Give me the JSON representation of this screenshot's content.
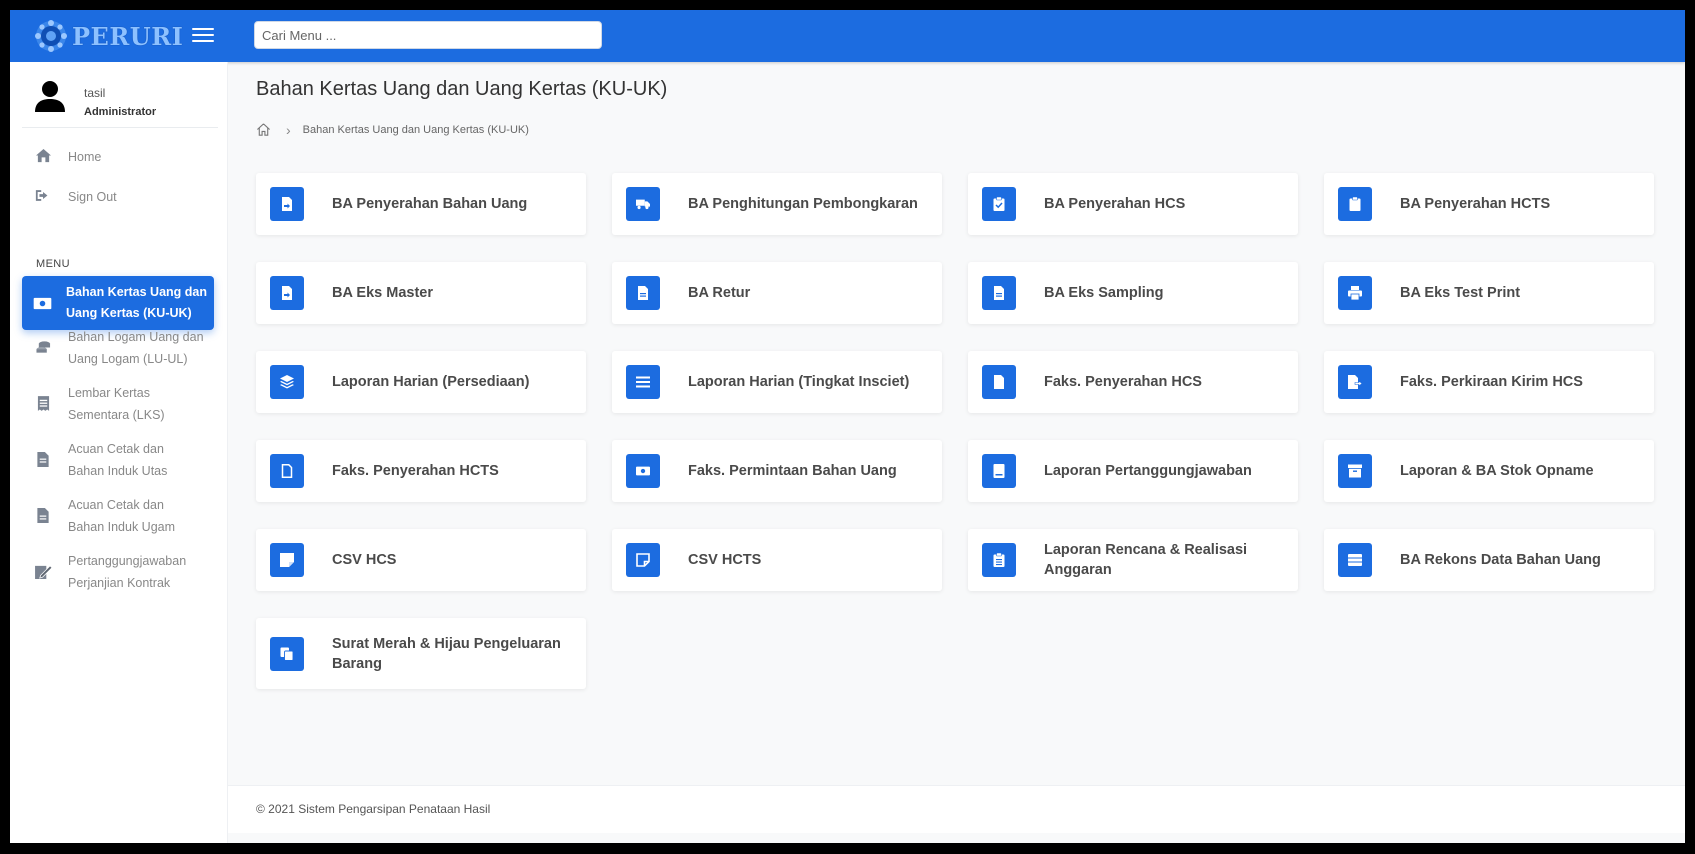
{
  "app": {
    "logo_text": "PERURI",
    "brand_color": "#1c6ce0"
  },
  "search": {
    "placeholder": "Cari Menu ...",
    "value": ""
  },
  "user": {
    "name": "tasil",
    "role": "Administrator"
  },
  "sidebar": {
    "top_items": [
      {
        "label": "Home",
        "icon": "home-icon"
      },
      {
        "label": "Sign Out",
        "icon": "sign-out-icon"
      }
    ],
    "menu_heading": "MENU",
    "menu_items": [
      {
        "label": "Bahan Kertas Uang dan Uang Kertas (KU-UK)",
        "line1": "Bahan Kertas Uang dan",
        "line2": "Uang Kertas (KU-UK)",
        "icon": "money-bill-icon",
        "active": true
      },
      {
        "label": "Bahan Logam Uang dan Uang Logam (LU-UL)",
        "line1": "Bahan Logam Uang dan",
        "line2": "Uang Logam (LU-UL)",
        "icon": "coins-icon",
        "active": false
      },
      {
        "label": "Lembar Kertas Sementara (LKS)",
        "line1": "Lembar Kertas",
        "line2": "Sementara (LKS)",
        "icon": "receipt-icon",
        "active": false
      },
      {
        "label": "Acuan Cetak dan Bahan Induk Utas",
        "line1": "Acuan Cetak dan",
        "line2": "Bahan Induk Utas",
        "icon": "file-alt-icon",
        "active": false
      },
      {
        "label": "Acuan Cetak dan Bahan Induk Ugam",
        "line1": "Acuan Cetak dan",
        "line2": "Bahan Induk Ugam",
        "icon": "file-icon",
        "active": false
      },
      {
        "label": "Pertanggungjawaban Perjanjian Kontrak",
        "line1": "Pertanggungjawaban",
        "line2": "Perjanjian Kontrak",
        "icon": "signature-icon",
        "active": false
      }
    ]
  },
  "main": {
    "title": "Bahan Kertas Uang dan Uang Kertas (KU-UK)",
    "breadcrumb": [
      "Bahan Kertas Uang dan Uang Kertas (KU-UK)"
    ],
    "cards": [
      {
        "title": "BA Penyerahan Bahan Uang",
        "icon": "file-import-icon"
      },
      {
        "title": "BA Penghitungan Pembongkaran",
        "icon": "truck-icon"
      },
      {
        "title": "BA Penyerahan HCS",
        "icon": "clipboard-check-icon"
      },
      {
        "title": "BA Penyerahan HCTS",
        "icon": "clipboard-icon"
      },
      {
        "title": "BA Eks Master",
        "icon": "file-import-icon"
      },
      {
        "title": "BA Retur",
        "icon": "file-alt-icon"
      },
      {
        "title": "BA Eks Sampling",
        "icon": "file-alt-icon"
      },
      {
        "title": "BA Eks Test Print",
        "icon": "print-icon"
      },
      {
        "title": "Laporan Harian (Persediaan)",
        "icon": "layer-group-icon"
      },
      {
        "title": "Laporan Harian (Tingkat Insciet)",
        "icon": "list-icon"
      },
      {
        "title": "Faks. Penyerahan HCS",
        "icon": "file-icon"
      },
      {
        "title": "Faks. Perkiraan Kirim HCS",
        "icon": "file-export-icon"
      },
      {
        "title": "Faks. Penyerahan HCTS",
        "icon": "file-outline-icon"
      },
      {
        "title": "Faks. Permintaan Bahan Uang",
        "icon": "money-bill-icon"
      },
      {
        "title": "Laporan Pertanggungjawaban",
        "icon": "book-icon"
      },
      {
        "title": "Laporan & BA Stok Opname",
        "icon": "archive-icon"
      },
      {
        "title": "CSV HCS",
        "icon": "sticky-note-icon"
      },
      {
        "title": "CSV HCTS",
        "icon": "sticky-note-outline-icon"
      },
      {
        "title": "Laporan Rencana & Realisasi Anggaran",
        "icon": "clipboard-list-icon"
      },
      {
        "title": "BA Rekons Data Bahan Uang",
        "icon": "table-icon"
      },
      {
        "title": "Surat Merah & Hijau Pengeluaran Barang",
        "icon": "copy-icon"
      }
    ]
  },
  "footer": {
    "text": "© 2021 Sistem Pengarsipan Penataan Hasil"
  }
}
